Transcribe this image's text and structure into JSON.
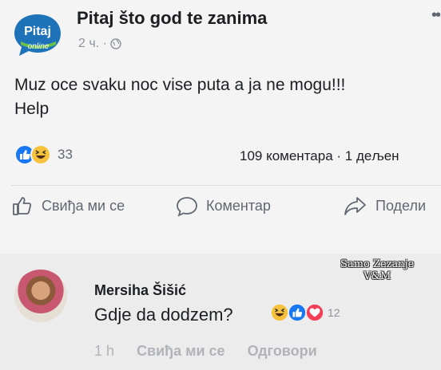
{
  "post": {
    "page_name": "Pitaj što god te zanima",
    "avatar_text_top": "Pitaj",
    "avatar_text_bottom": "online",
    "time": "2 ч. ·",
    "text_line1": "Muz oce svaku noc vise puta a ja ne mogu!!!",
    "text_line2": "Help",
    "reaction_count": "33",
    "comments_shares": "109 коментара · 1 дељен",
    "actions": {
      "like": "Свиђа ми се",
      "comment": "Коментар",
      "share": "Подели"
    },
    "icons": [
      "page-avatar-icon",
      "globe-icon",
      "more-icon",
      "like-reaction-icon",
      "haha-reaction-icon",
      "like-outline-icon",
      "comment-outline-icon",
      "share-outline-icon"
    ]
  },
  "watermark": {
    "line1": "Samo Zezanje",
    "line2": "V&M"
  },
  "comment": {
    "author": "Mersiha Šišić",
    "text": "Gdje da dodzem?",
    "reaction_count": "12",
    "time": "1 h",
    "like": "Свиђа ми се",
    "reply": "Одговори"
  },
  "colors": {
    "page_brand": "#1e73b8",
    "like_blue": "#1877f2",
    "haha_yellow": "#f7c23b",
    "love_red": "#f33e58"
  }
}
